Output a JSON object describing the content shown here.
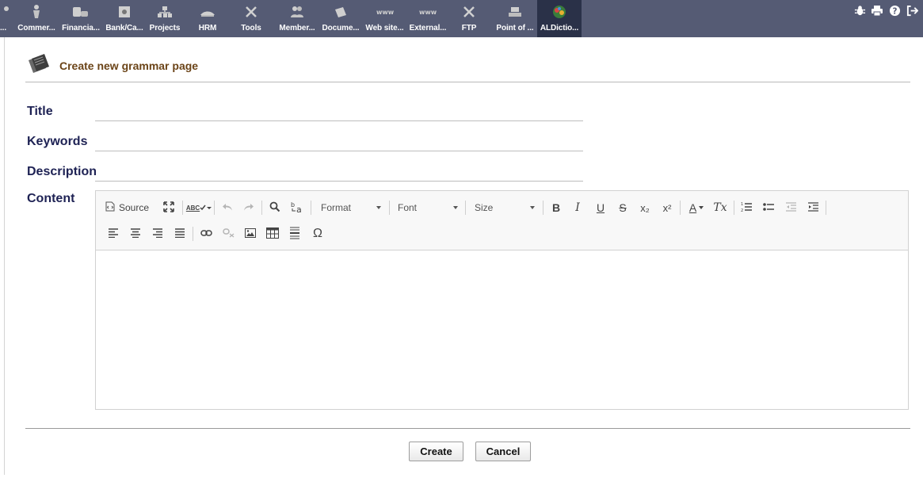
{
  "topmenu": {
    "items": [
      {
        "label": "...",
        "icon": "generic-icon"
      },
      {
        "label": "Commer...",
        "icon": "commercial-icon"
      },
      {
        "label": "Financia...",
        "icon": "financial-icon"
      },
      {
        "label": "Bank/Ca...",
        "icon": "bank-icon"
      },
      {
        "label": "Projects",
        "icon": "projects-icon"
      },
      {
        "label": "HRM",
        "icon": "hrm-icon"
      },
      {
        "label": "Tools",
        "icon": "tools-icon"
      },
      {
        "label": "Member...",
        "icon": "members-icon"
      },
      {
        "label": "Docume...",
        "icon": "documents-icon"
      },
      {
        "label": "Web site...",
        "icon": "website-icon"
      },
      {
        "label": "External...",
        "icon": "external-icon"
      },
      {
        "label": "FTP",
        "icon": "ftp-icon"
      },
      {
        "label": "Point of ...",
        "icon": "pos-icon"
      },
      {
        "label": "ALDictio...",
        "icon": "aldictionary-icon"
      }
    ],
    "active_index": 13,
    "right_icons": [
      "bug-icon",
      "print-icon",
      "help-icon",
      "logout-icon"
    ]
  },
  "page": {
    "title": "Create new grammar page"
  },
  "form": {
    "title_label": "Title",
    "title_value": "",
    "keywords_label": "Keywords",
    "keywords_value": "",
    "description_label": "Description",
    "description_value": "",
    "content_label": "Content"
  },
  "editor": {
    "source_label": "Source",
    "format_label": "Format",
    "font_label": "Font",
    "size_label": "Size",
    "bold_glyph": "B",
    "italic_glyph": "I",
    "underline_glyph": "U",
    "strike_glyph": "S",
    "subscript_glyph": "x₂",
    "superscript_glyph": "x²",
    "textcolor_glyph": "A",
    "removeformat_glyph": "Tx",
    "specialchar_glyph": "Ω",
    "spellcheck_glyph": "ABC",
    "content": ""
  },
  "buttons": {
    "create": "Create",
    "cancel": "Cancel"
  },
  "colors": {
    "topbar": "#555b74",
    "topbar_active": "#2a3148",
    "page_title": "#6b4418",
    "form_label": "#1e2254"
  }
}
